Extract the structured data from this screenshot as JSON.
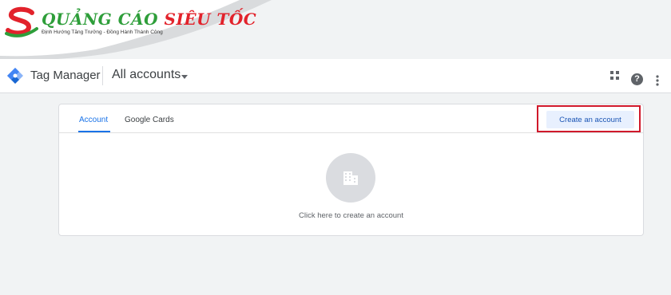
{
  "watermark": {
    "brand_part1": "QUẢNG CÁO",
    "brand_part2": "SIÊU TỐC",
    "tagline": "Định Hướng Tăng Trưởng - Đồng Hành Thành Công",
    "colors": {
      "green": "#2e9e3a",
      "red": "#e2222b"
    }
  },
  "header": {
    "product_name": "Tag Manager",
    "account_picker": "All accounts",
    "icons": [
      "tag-manager-logo-icon",
      "apps-grid-icon",
      "help-icon",
      "more-vert-icon"
    ],
    "help_glyph": "?"
  },
  "tabs": [
    {
      "label": "Account",
      "active": true
    },
    {
      "label": "Google Cards",
      "active": false
    }
  ],
  "actions": {
    "create_account_label": "Create an account"
  },
  "empty_state": {
    "text": "Click here to create an account",
    "icon": "building-icon"
  },
  "colors": {
    "accent": "#1a73e8",
    "highlight": "#d0192b",
    "button_bg": "#e8f0fe"
  }
}
